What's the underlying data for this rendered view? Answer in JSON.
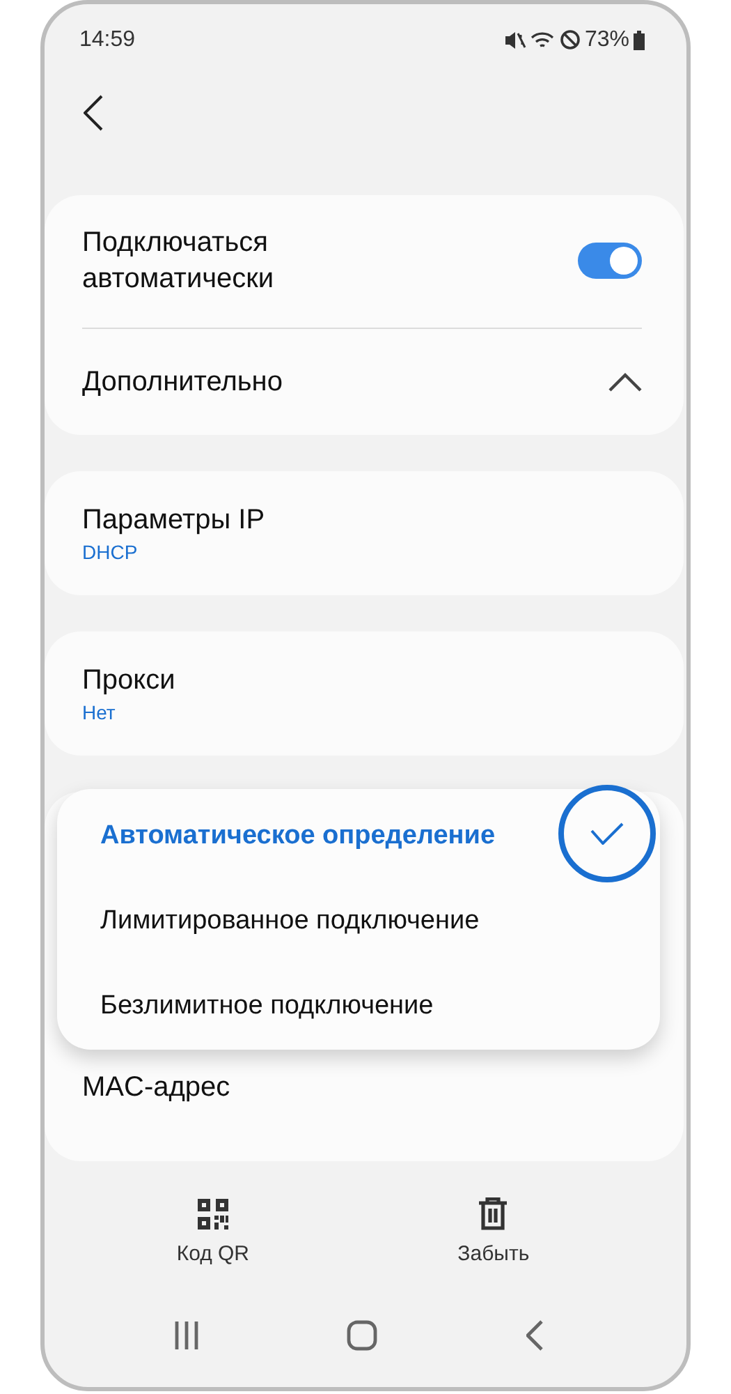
{
  "status_bar": {
    "time": "14:59",
    "battery": "73%"
  },
  "auto_connect": {
    "label": "Подключаться автоматически",
    "on": true
  },
  "advanced": {
    "label": "Дополнительно",
    "expanded": true
  },
  "settings": [
    {
      "title": "Параметры IP",
      "value": "DHCP"
    },
    {
      "title": "Прокси",
      "value": "Нет"
    }
  ],
  "metered_menu": [
    {
      "label": "Автоматическое определение",
      "selected": true
    },
    {
      "label": "Лимитированное подключение",
      "selected": false
    },
    {
      "label": "Безлимитное подключение",
      "selected": false
    }
  ],
  "mac_address": {
    "title": "MAC-адрес"
  },
  "actions": [
    {
      "kind": "qr",
      "label": "Код QR"
    },
    {
      "kind": "trash",
      "label": "Забыть"
    }
  ]
}
